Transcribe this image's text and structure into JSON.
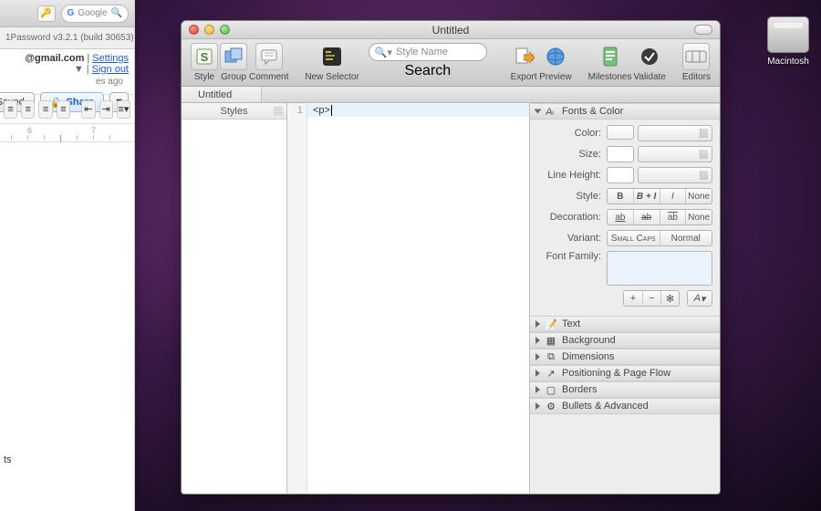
{
  "desktop": {
    "drive_label": "Macintosh"
  },
  "bg_browser": {
    "search_placeholder": "Google",
    "bookmark_bar": "1Password v3.2.1 (build 30653)",
    "account": "@gmail.com",
    "settings": "Settings",
    "signout": "Sign out",
    "timestamp": "es ago",
    "saved_btn": "Saved",
    "share_btn": "Share",
    "ruler": {
      "six": "6",
      "seven": "7"
    }
  },
  "window": {
    "title": "Untitled",
    "toolbar": {
      "style": "Style",
      "group": "Group",
      "comment": "Comment",
      "new_selector": "New Selector",
      "search_placeholder": "Style Name",
      "search_label": "Search",
      "export": "Export",
      "preview": "Preview",
      "milestones": "Milestones",
      "validate": "Validate",
      "editors": "Editors"
    },
    "tab": "Untitled",
    "sidebar_header": "Styles",
    "editor": {
      "line_number": "1",
      "line_content": "<p>"
    },
    "inspector": {
      "fonts_color": "Fonts & Color",
      "color": "Color:",
      "size": "Size:",
      "line_height": "Line Height:",
      "style": "Style:",
      "style_opts": {
        "b": "B",
        "bi": "B + I",
        "i": "I",
        "none": "None"
      },
      "decoration": "Decoration:",
      "dec_opts": {
        "none": "None"
      },
      "variant": "Variant:",
      "variant_opts": {
        "smallcaps": "Small Caps",
        "normal": "Normal"
      },
      "font_family": "Font Family:",
      "font_menu": "A",
      "sections": {
        "text": "Text",
        "background": "Background",
        "dimensions": "Dimensions",
        "positioning": "Positioning & Page Flow",
        "borders": "Borders",
        "bullets": "Bullets & Advanced"
      }
    }
  }
}
